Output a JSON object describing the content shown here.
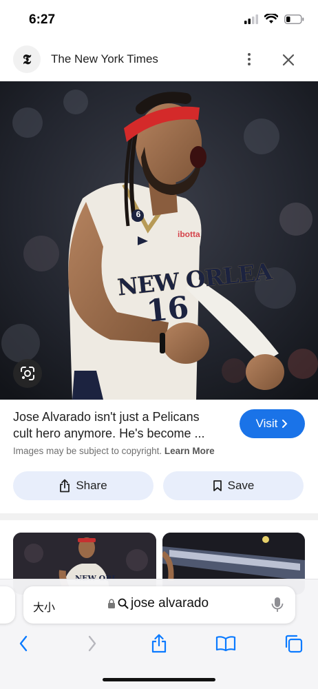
{
  "status_bar": {
    "time": "6:27"
  },
  "header": {
    "logo_glyph": "𝕿",
    "site_name": "The New York Times"
  },
  "hero": {
    "jersey_text": "NEW ORLEA",
    "jersey_number": "16",
    "sponsor": "ibotta",
    "patch": "6"
  },
  "result": {
    "title_line1": "Jose Alvarado isn't just a Pelicans",
    "title_line2": "cult hero anymore. He's become ...",
    "visit_label": "Visit",
    "copyright_text": "Images may be subject to copyright.",
    "learn_more_label": "Learn More",
    "share_label": "Share",
    "save_label": "Save"
  },
  "thumbnails": {
    "jersey_text": "NEW ORL"
  },
  "browser": {
    "text_size_label": "大小",
    "search_query": "jose alvarado"
  },
  "colors": {
    "accent": "#1a73e8",
    "action_bg": "#e8eefb",
    "safari_blue": "#0a7aff",
    "headband": "#d42a2a"
  }
}
